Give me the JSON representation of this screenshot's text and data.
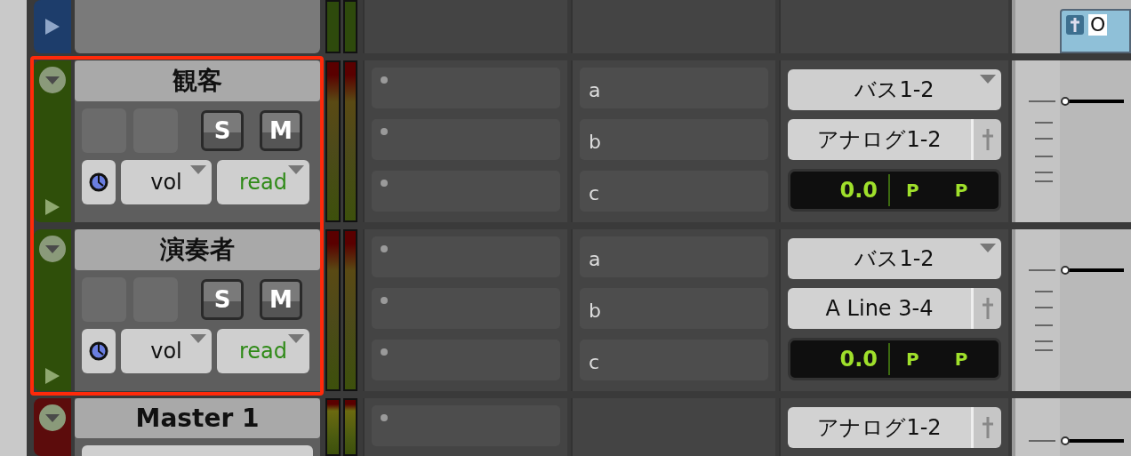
{
  "top_track": {
    "color": "#1d3d6b",
    "clip_label": "O"
  },
  "annotation_frame": true,
  "tracks": [
    {
      "name": "観客",
      "color": "#2f4f0a",
      "expanded": true,
      "solo_label": "S",
      "mute_label": "M",
      "solo": false,
      "mute": false,
      "automation_target": "vol",
      "automation_mode": "read",
      "sends": [
        "a",
        "b",
        "c"
      ],
      "output": "バス1-2",
      "input": "アナログ1-2",
      "volume": "0.0",
      "pan_left": "P",
      "pan_right": "P"
    },
    {
      "name": "演奏者",
      "color": "#2f4f0a",
      "expanded": true,
      "solo_label": "S",
      "mute_label": "M",
      "solo": false,
      "mute": false,
      "automation_target": "vol",
      "automation_mode": "read",
      "sends": [
        "a",
        "b",
        "c"
      ],
      "output": "バス1-2",
      "input": "A Line 3-4",
      "volume": "0.0",
      "pan_left": "P",
      "pan_right": "P"
    }
  ],
  "master": {
    "name": "Master 1",
    "color": "#5c0c0c",
    "expanded": true,
    "output": "アナログ1-2"
  }
}
